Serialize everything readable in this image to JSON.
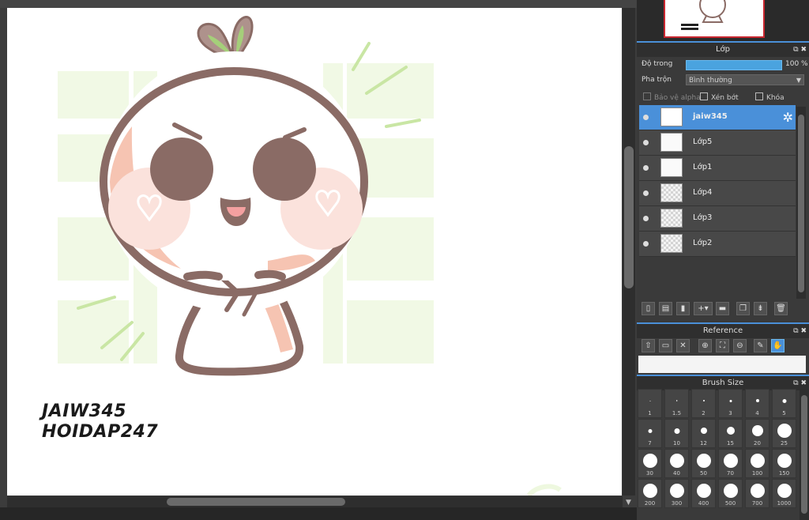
{
  "artwork": {
    "signature_line1": "JAIW345",
    "signature_line2": "HOIDAP247"
  },
  "layer_panel": {
    "title": "Lớp",
    "opacity_label": "Độ trong",
    "opacity_value": "100 %",
    "opacity_percent": 100,
    "blend_label": "Pha trộn",
    "blend_value": "Bình thường",
    "protect_alpha": "Bảo vệ alpha",
    "clipping": "Xén bớt",
    "lock": "Khóa",
    "layers": [
      {
        "name": "jaiw345",
        "active": true
      },
      {
        "name": "Lớp5",
        "active": false
      },
      {
        "name": "Lớp1",
        "active": false
      },
      {
        "name": "Lớp4",
        "active": false
      },
      {
        "name": "Lớp3",
        "active": false
      },
      {
        "name": "Lớp2",
        "active": false
      }
    ]
  },
  "reference_panel": {
    "title": "Reference"
  },
  "brush_panel": {
    "title": "Brush Size",
    "sizes": [
      "1",
      "1.5",
      "2",
      "3",
      "4",
      "5",
      "7",
      "10",
      "12",
      "15",
      "20",
      "25",
      "30",
      "40",
      "50",
      "70",
      "100",
      "150",
      "200",
      "300",
      "400",
      "500",
      "700",
      "1000"
    ]
  },
  "colors": {
    "accent": "#4a90d9",
    "panel_bg": "#3a3a3a",
    "layer_bg": "#484848"
  }
}
